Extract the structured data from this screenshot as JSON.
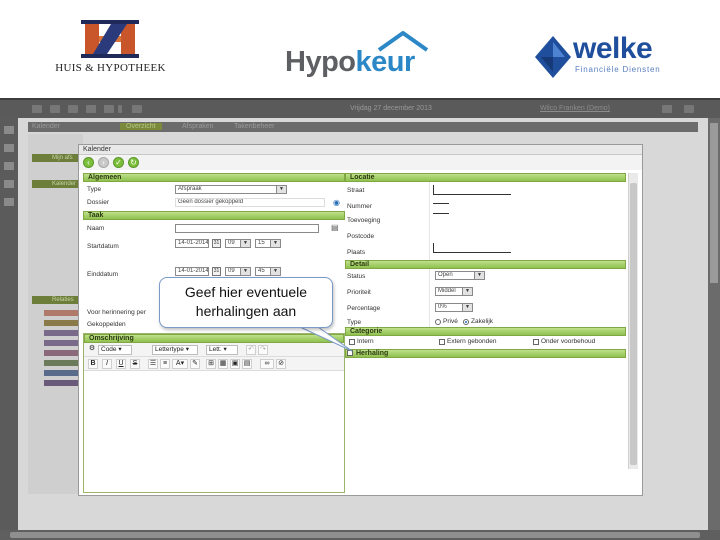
{
  "logos": {
    "huis": "HUIS & HYPOTHEEK",
    "hypokeur_a": "Hypo",
    "hypokeur_b": "keur",
    "welke": "welke",
    "welke_tag": "Financiële Diensten"
  },
  "app": {
    "top_date": "Vrijdag 27 december 2013",
    "user": "Wilco Franken (Demo)",
    "bg_tabs": [
      "Kalender",
      "Overzicht",
      "Afspraken",
      "Takenbeheer"
    ],
    "bg_panel_labels": [
      "Mijn afs",
      "Kalender",
      "Relaties"
    ]
  },
  "dialog": {
    "title": "Kalender",
    "sections": {
      "algemeen": "Algemeen",
      "taak": "Taak",
      "omschrijving": "Omschrijving",
      "locatie": "Locatie",
      "detail": "Detail",
      "categorie": "Categorie",
      "herhaling": "Herhaling"
    },
    "left": {
      "type_label": "Type",
      "type_value": "Afspraak",
      "dossier_label": "Dossier",
      "dossier_value": "Geen dossier gekoppeld",
      "naam_label": "Naam",
      "startdatum_label": "Startdatum",
      "startdatum_value": "14-01-2014",
      "start_hour": "09",
      "start_min": "15",
      "einddatum_label": "Einddatum",
      "einddatum_value": "14-01-2014",
      "end_hour": "09",
      "end_min": "45",
      "herinnering_label": "Voor herinnering per",
      "gekoppelde_label": "Gekoppelden"
    },
    "right": {
      "straat_label": "Straat",
      "nummer_label": "Nummer",
      "toevoeging_label": "Toevoeging",
      "postcode_label": "Postcode",
      "plaats_label": "Plaats",
      "status_label": "Status",
      "status_value": "Open",
      "prioriteit_label": "Prioriteit",
      "prioriteit_value": "Middel",
      "percentage_label": "Percentage",
      "percentage_value": "0%",
      "type_label": "Type",
      "type_prive": "Privé",
      "type_zakelijk": "Zakelijk",
      "cat_1": "Intern",
      "cat_2": "Extern gebonden",
      "cat_3": "Onder voorbehoud"
    },
    "editor": {
      "code_label": "Code",
      "font_label": "Lettertype",
      "size_label": "Lett.",
      "bold": "B",
      "italic": "I",
      "underline": "U",
      "strike": "S"
    }
  },
  "callout": {
    "line1": "Geef hier eventuele",
    "line2": "herhalingen aan"
  },
  "colors": {
    "section_green": "#8fc14f",
    "hypokeur_blue": "#2b87c6",
    "welke_blue": "#1f4f9c",
    "huis_orange": "#c8562a"
  }
}
